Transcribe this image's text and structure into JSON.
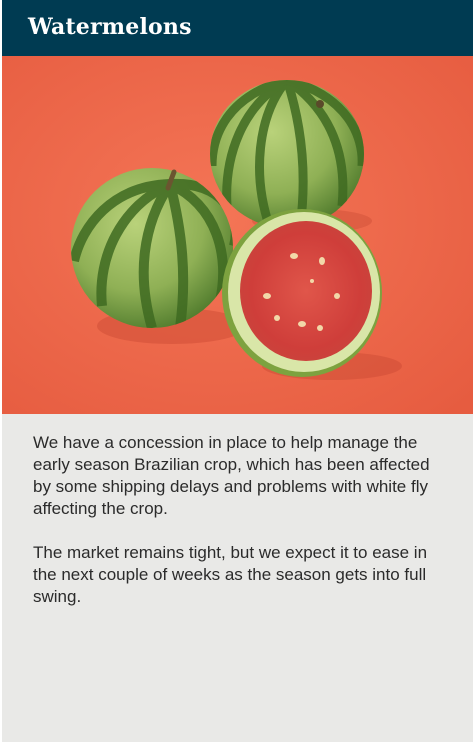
{
  "card": {
    "title": "Watermelons",
    "image": {
      "icon": "watermelon-photo",
      "background_color": "#ee6a4c"
    },
    "paragraphs": [
      "We have a concession in place to help manage the early season Brazilian crop, which has been affected by some shipping delays and problems with white fly affecting the crop.",
      "The market remains tight, but we expect it to ease in the next couple of weeks as the season gets into full swing."
    ]
  },
  "colors": {
    "header_bg": "#003b52",
    "header_text": "#ffffff",
    "body_bg": "#e9e9e7",
    "body_text": "#2b2b2b"
  }
}
